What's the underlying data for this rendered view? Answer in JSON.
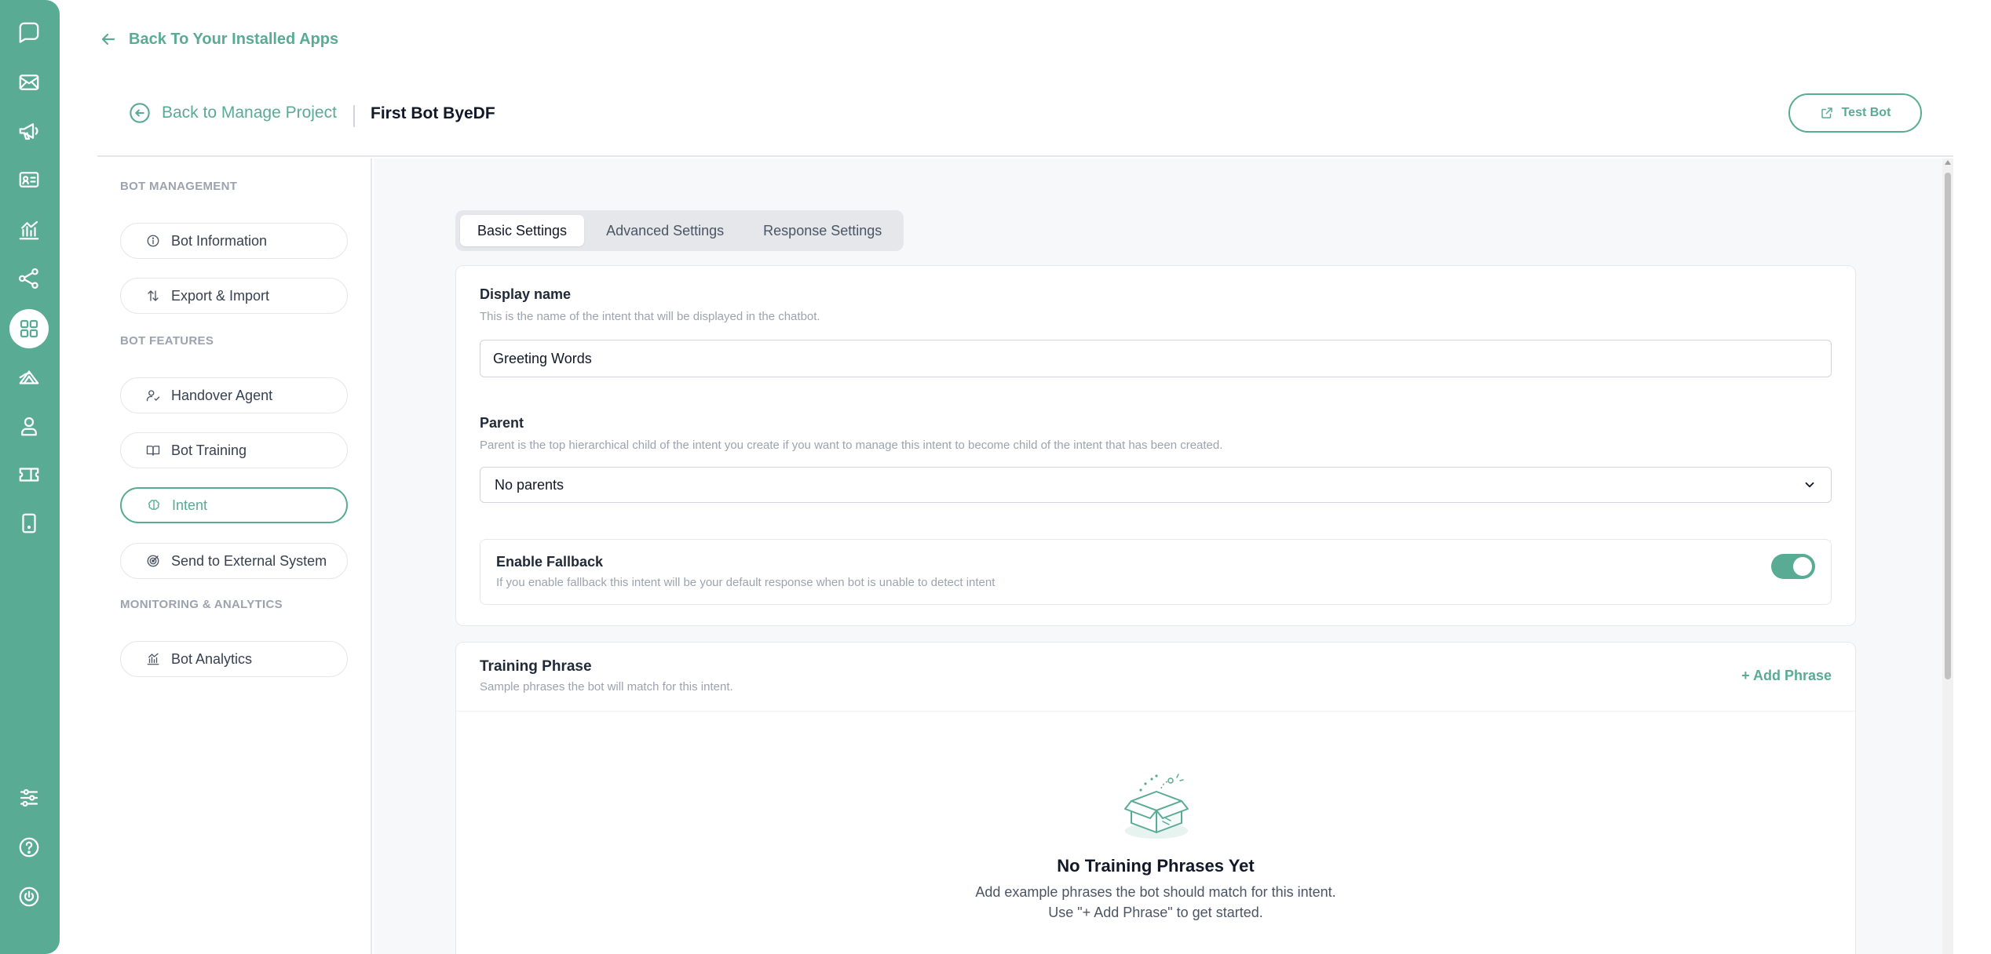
{
  "nav": {
    "back_to_apps": "Back To Your Installed Apps",
    "back_to_project": "Back to Manage Project",
    "bot_name": "First Bot ByeDF",
    "test_bot": "Test Bot"
  },
  "rail_icons": [
    "chat-icon",
    "mail-icon",
    "megaphone-icon",
    "contact-card-icon",
    "analytics-icon",
    "share-icon",
    "apps-grid-icon",
    "broadcast-icon",
    "agent-icon",
    "ticket-icon",
    "mobile-icon",
    "settings-sliders-icon",
    "help-icon",
    "power-icon"
  ],
  "sidebar": {
    "section_management": "BOT MANAGEMENT",
    "section_features": "BOT FEATURES",
    "section_monitoring": "MONITORING & ANALYTICS",
    "items": [
      {
        "label": "Bot Information",
        "icon": "info-icon"
      },
      {
        "label": "Export & Import",
        "icon": "swap-icon"
      },
      {
        "label": "Handover Agent",
        "icon": "user-check-icon"
      },
      {
        "label": "Bot Training",
        "icon": "book-icon"
      },
      {
        "label": "Intent",
        "icon": "brain-icon",
        "active": true
      },
      {
        "label": "Send to External System",
        "icon": "target-icon"
      },
      {
        "label": "Bot Analytics",
        "icon": "chart-icon"
      }
    ]
  },
  "tabs": [
    {
      "label": "Basic Settings",
      "active": true
    },
    {
      "label": "Advanced Settings"
    },
    {
      "label": "Response Settings"
    }
  ],
  "form": {
    "display_name_label": "Display name",
    "display_name_desc": "This is the name of the intent that will be displayed in the chatbot.",
    "display_name_value": "Greeting Words",
    "parent_label": "Parent",
    "parent_desc": "Parent is the top hierarchical child of the intent you create if you want to manage this intent to become child of the intent that has been created.",
    "parent_value": "No parents",
    "fallback_label": "Enable Fallback",
    "fallback_desc": "If you enable fallback this intent will be your default response when bot is unable to detect intent",
    "fallback_enabled": true
  },
  "training": {
    "title": "Training Phrase",
    "desc": "Sample phrases the bot will match for this intent.",
    "add_phrase": "+ Add Phrase",
    "empty_title": "No Training Phrases Yet",
    "empty_line1": "Add example phrases the bot should match for this intent.",
    "empty_line2": "Use \"+ Add Phrase\" to get started."
  },
  "colors": {
    "accent": "#5aab93",
    "rail": "#5aab93",
    "content_bg": "#f7f8fa"
  }
}
